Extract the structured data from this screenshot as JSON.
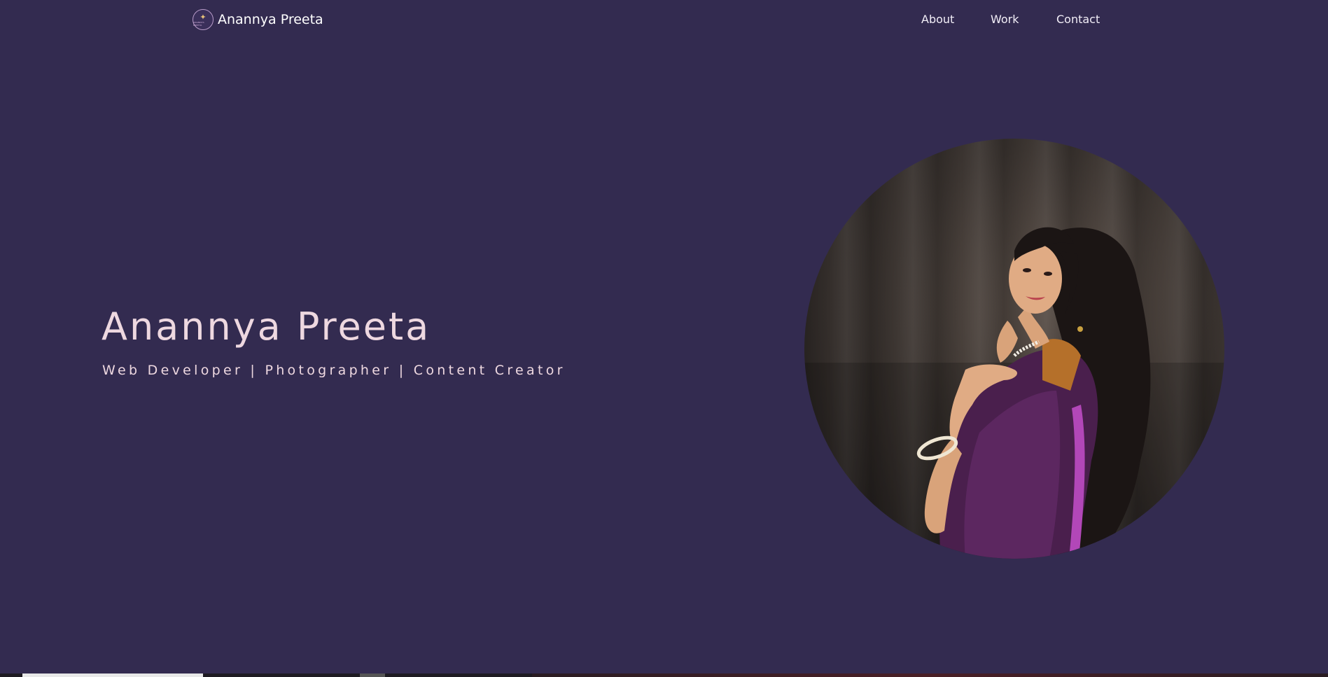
{
  "nav": {
    "logo": {
      "text": "ANANNYA PREETA",
      "icon": "sparkle-star-icon",
      "accent_color": "#e8c27a"
    },
    "brand_name": "Anannya Preeta",
    "links": [
      {
        "label": "About"
      },
      {
        "label": "Work"
      },
      {
        "label": "Contact"
      }
    ]
  },
  "hero": {
    "name": "Anannya Preeta",
    "tagline": "Web Developer | Photographer | Content Creator",
    "portrait": {
      "shape": "circle"
    }
  },
  "colors": {
    "background": "#332b50",
    "hero_text": "#eed8e0",
    "nav_text": "#ffffff"
  }
}
